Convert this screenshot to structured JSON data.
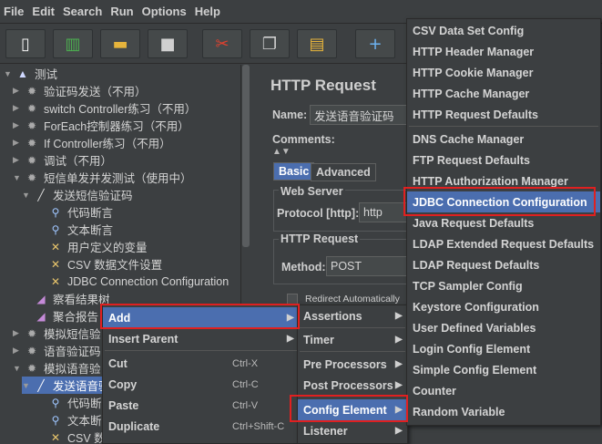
{
  "menubar": [
    "File",
    "Edit",
    "Search",
    "Run",
    "Options",
    "Help"
  ],
  "toolbar": [
    {
      "icon": "new-icon",
      "glyph": "▯",
      "color": "#f3f3f3"
    },
    {
      "icon": "templates-icon",
      "glyph": "▥",
      "color": "#4caf50"
    },
    {
      "icon": "open-icon",
      "glyph": "▬",
      "color": "#e6b43c"
    },
    {
      "icon": "save-icon",
      "glyph": "■",
      "color": "#d0d0d0"
    },
    {
      "icon": "cut-icon",
      "glyph": "✂",
      "color": "#e0412f"
    },
    {
      "icon": "copy-icon",
      "glyph": "❐",
      "color": "#d0d0d0"
    },
    {
      "icon": "paste-icon",
      "glyph": "▤",
      "color": "#e6b43c"
    },
    {
      "icon": "expand-icon",
      "glyph": "+",
      "color": "#6db3f2"
    }
  ],
  "tree": [
    {
      "label": "测试",
      "indent": 0,
      "icon": "flask-icon",
      "glyph": "▲",
      "color": "#cfd8ff",
      "arrow": "▼"
    },
    {
      "label": "验证码发送（不用）",
      "indent": 1,
      "icon": "gear-icon",
      "glyph": "✹",
      "color": "#aaaaaa",
      "arrow": "▶"
    },
    {
      "label": "switch Controller练习（不用）",
      "indent": 1,
      "icon": "gear-icon",
      "glyph": "✹",
      "color": "#aaaaaa",
      "arrow": "▶"
    },
    {
      "label": "ForEach控制器练习（不用）",
      "indent": 1,
      "icon": "gear-icon",
      "glyph": "✹",
      "color": "#aaaaaa",
      "arrow": "▶"
    },
    {
      "label": "If Controller练习（不用）",
      "indent": 1,
      "icon": "gear-icon",
      "glyph": "✹",
      "color": "#aaaaaa",
      "arrow": "▶"
    },
    {
      "label": "调试（不用）",
      "indent": 1,
      "icon": "gear-icon",
      "glyph": "✹",
      "color": "#aaaaaa",
      "arrow": "▶"
    },
    {
      "label": "短信单发并发测试（使用中）",
      "indent": 1,
      "icon": "gear-icon",
      "glyph": "✹",
      "color": "#aaaaaa",
      "arrow": "▼"
    },
    {
      "label": "发送短信验证码",
      "indent": 2,
      "icon": "pen-icon",
      "glyph": "╱",
      "color": "#dddddd",
      "arrow": "▼"
    },
    {
      "label": "代码断言",
      "indent": 3,
      "icon": "magnifier-icon",
      "glyph": "⚲",
      "color": "#9fc6ff",
      "arrow": ""
    },
    {
      "label": "文本断言",
      "indent": 3,
      "icon": "magnifier-icon",
      "glyph": "⚲",
      "color": "#9fc6ff",
      "arrow": ""
    },
    {
      "label": "用户定义的变量",
      "indent": 3,
      "icon": "wrench-icon",
      "glyph": "✕",
      "color": "#e8c56c",
      "arrow": ""
    },
    {
      "label": "CSV 数据文件设置",
      "indent": 3,
      "icon": "wrench-icon",
      "glyph": "✕",
      "color": "#e8c56c",
      "arrow": ""
    },
    {
      "label": "JDBC Connection Configuration",
      "indent": 3,
      "icon": "wrench-icon",
      "glyph": "✕",
      "color": "#e8c56c",
      "arrow": ""
    },
    {
      "label": "察看结果树",
      "indent": 2,
      "icon": "chart-icon",
      "glyph": "◢",
      "color": "#c58ad8",
      "arrow": ""
    },
    {
      "label": "聚合报告",
      "indent": 2,
      "icon": "chart-icon",
      "glyph": "◢",
      "color": "#c58ad8",
      "arrow": ""
    },
    {
      "label": "模拟短信验",
      "indent": 1,
      "icon": "gear-icon",
      "glyph": "✹",
      "color": "#aaaaaa",
      "arrow": "▶"
    },
    {
      "label": "语音验证码",
      "indent": 1,
      "icon": "gear-icon",
      "glyph": "✹",
      "color": "#aaaaaa",
      "arrow": "▶"
    },
    {
      "label": "模拟语音验",
      "indent": 1,
      "icon": "gear-icon",
      "glyph": "✹",
      "color": "#aaaaaa",
      "arrow": "▼"
    },
    {
      "label": "发送语音验",
      "indent": 2,
      "icon": "pen-icon",
      "glyph": "╱",
      "color": "#ffffff",
      "arrow": "▼",
      "selected": true
    },
    {
      "label": "代码断言",
      "indent": 3,
      "icon": "magnifier-icon",
      "glyph": "⚲",
      "color": "#9fc6ff",
      "arrow": ""
    },
    {
      "label": "文本断言",
      "indent": 3,
      "icon": "magnifier-icon",
      "glyph": "⚲",
      "color": "#9fc6ff",
      "arrow": ""
    },
    {
      "label": "CSV 数据",
      "indent": 3,
      "icon": "wrench-icon",
      "glyph": "✕",
      "color": "#e8c56c",
      "arrow": ""
    }
  ],
  "panel": {
    "title": "HTTP Request",
    "name_label": "Name:",
    "name_value": "发送语音验证码",
    "comments_label": "Comments:",
    "tabs": [
      "Basic",
      "Advanced"
    ],
    "web_server": "Web Server",
    "protocol_label": "Protocol [http]:",
    "protocol_value": "http",
    "http_request": "HTTP Request",
    "method_label": "Method:",
    "method_value": "POST",
    "redirect_label": "Redirect Automatically"
  },
  "context_menu": [
    {
      "label": "Add",
      "shortcut": "",
      "submenu": true,
      "highlight": true
    },
    {
      "label": "Insert Parent",
      "shortcut": "",
      "submenu": true
    },
    {
      "label": "Cut",
      "shortcut": "Ctrl-X"
    },
    {
      "label": "Copy",
      "shortcut": "Ctrl-C"
    },
    {
      "label": "Paste",
      "shortcut": "Ctrl-V"
    },
    {
      "label": "Duplicate",
      "shortcut": "Ctrl+Shift-C"
    }
  ],
  "add_menu": [
    {
      "label": "Assertions",
      "submenu": true
    },
    {
      "label": "Timer",
      "submenu": true
    },
    {
      "label": "Pre Processors",
      "submenu": true
    },
    {
      "label": "Post Processors",
      "submenu": true
    },
    {
      "label": "Config Element",
      "submenu": true,
      "highlight": true
    },
    {
      "label": "Listener",
      "submenu": true
    }
  ],
  "config_menu": [
    "CSV Data Set Config",
    "HTTP Header Manager",
    "HTTP Cookie Manager",
    "HTTP Cache Manager",
    "HTTP Request Defaults",
    "DNS Cache Manager",
    "FTP Request Defaults",
    "HTTP Authorization Manager",
    "JDBC Connection Configuration",
    "Java Request Defaults",
    "LDAP Extended Request Defaults",
    "LDAP Request Defaults",
    "TCP Sampler Config",
    "Keystore Configuration",
    "User Defined Variables",
    "Login Config Element",
    "Simple Config Element",
    "Counter",
    "Random Variable"
  ],
  "config_highlight_index": 8,
  "colors": {
    "highlight": "#4b6eaf",
    "annotation": "#e02020",
    "background": "#3c3f41"
  }
}
